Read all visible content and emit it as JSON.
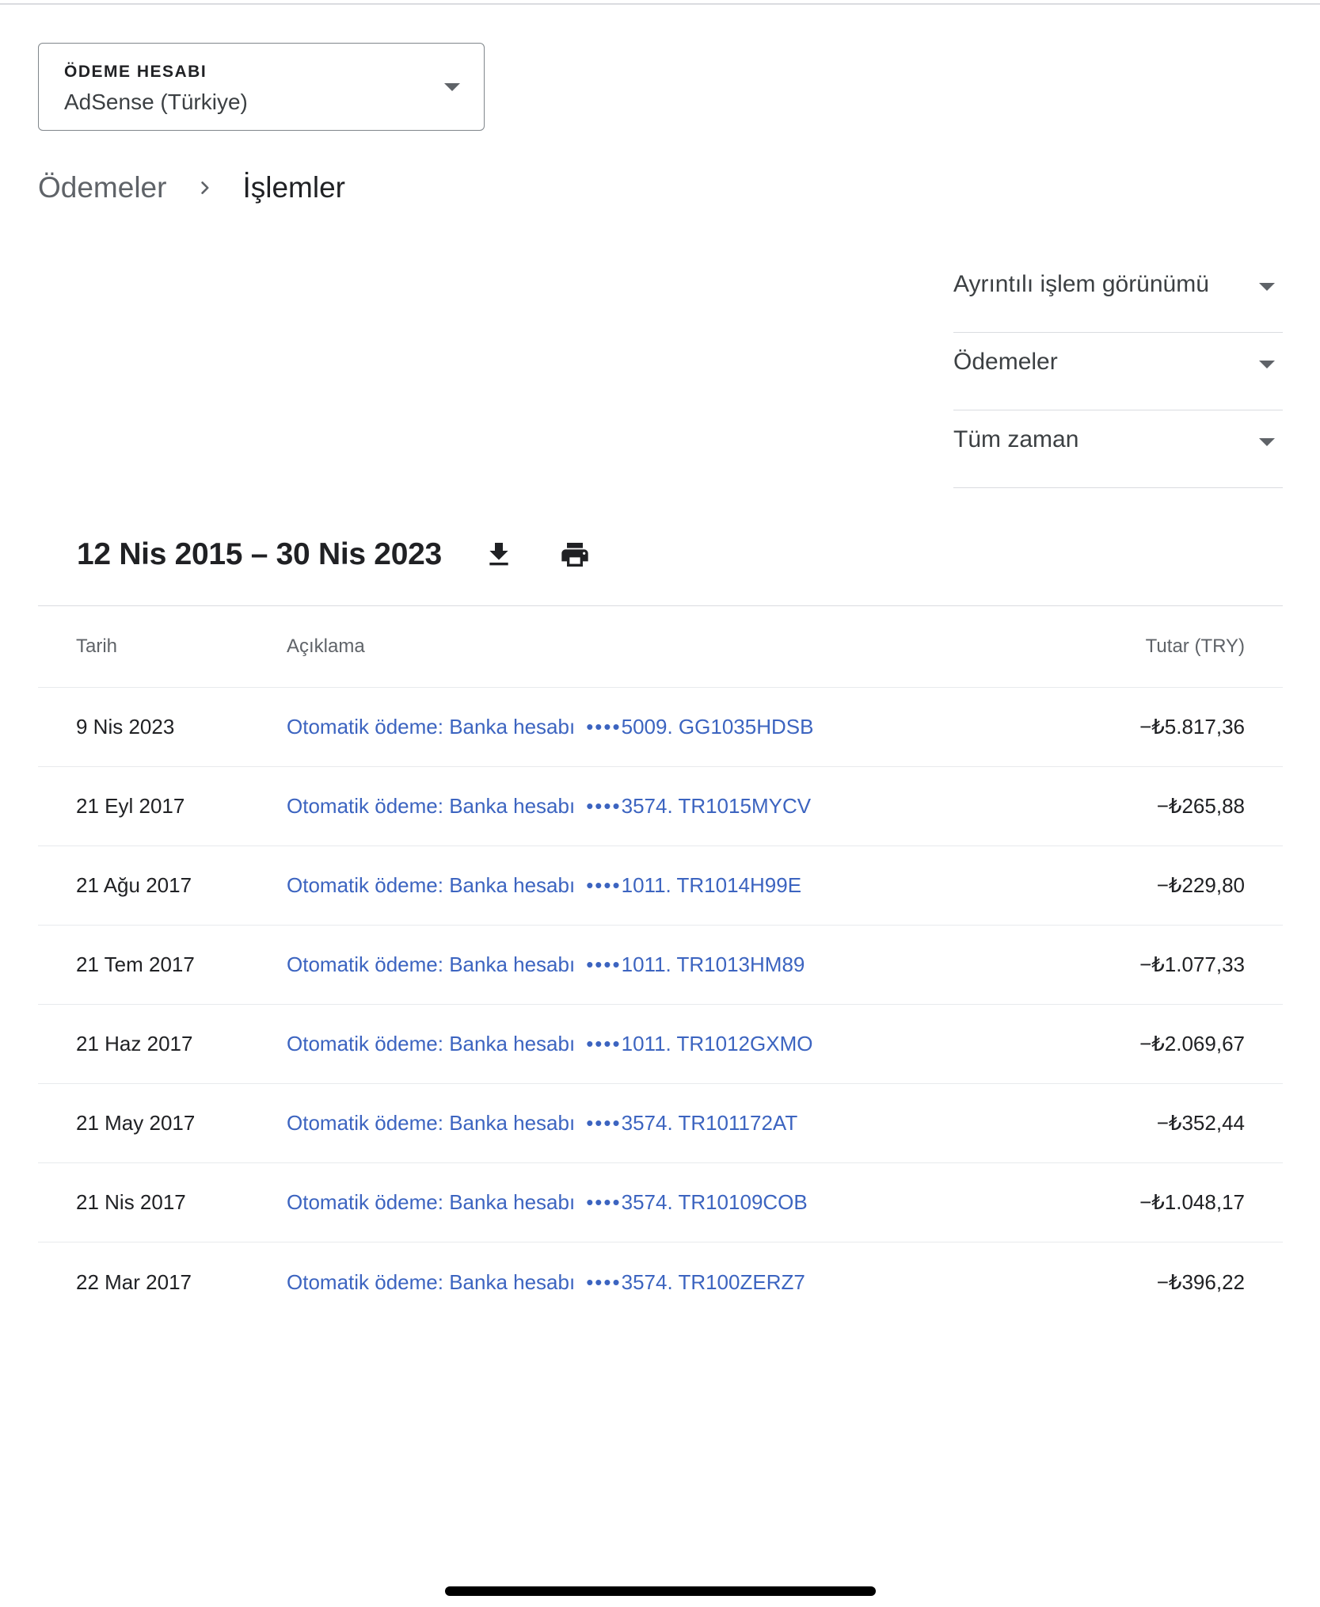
{
  "account": {
    "label": "ÖDEME HESABI",
    "value": "AdSense (Türkiye)"
  },
  "breadcrumb": {
    "parent": "Ödemeler",
    "current": "İşlemler"
  },
  "filters": [
    {
      "label": "Ayrıntılı işlem görünümü"
    },
    {
      "label": "Ödemeler"
    },
    {
      "label": "Tüm zaman"
    }
  ],
  "range": {
    "title": "12 Nis 2015 – 30 Nis 2023"
  },
  "icons": [
    "chevron-right-icon",
    "dropdown-arrow-icon",
    "download-icon",
    "print-icon"
  ],
  "table": {
    "headers": {
      "date": "Tarih",
      "description": "Açıklama",
      "amount": "Tutar (TRY)"
    },
    "rows": [
      {
        "date": "9 Nis 2023",
        "desc": "Otomatik ödeme: Banka hesabı",
        "dots": "••••",
        "ref": "5009. GG1035HDSB",
        "amount": "−₺5.817,36"
      },
      {
        "date": "21 Eyl 2017",
        "desc": "Otomatik ödeme: Banka hesabı",
        "dots": "••••",
        "ref": "3574. TR1015MYCV",
        "amount": "−₺265,88"
      },
      {
        "date": "21 Ağu 2017",
        "desc": "Otomatik ödeme: Banka hesabı",
        "dots": "••••",
        "ref": "1011. TR1014H99E",
        "amount": "−₺229,80"
      },
      {
        "date": "21 Tem 2017",
        "desc": "Otomatik ödeme: Banka hesabı",
        "dots": "••••",
        "ref": "1011. TR1013HM89",
        "amount": "−₺1.077,33"
      },
      {
        "date": "21 Haz 2017",
        "desc": "Otomatik ödeme: Banka hesabı",
        "dots": "••••",
        "ref": "1011. TR1012GXMO",
        "amount": "−₺2.069,67"
      },
      {
        "date": "21 May 2017",
        "desc": "Otomatik ödeme: Banka hesabı",
        "dots": "••••",
        "ref": "3574. TR101172AT",
        "amount": "−₺352,44"
      },
      {
        "date": "21 Nis 2017",
        "desc": "Otomatik ödeme: Banka hesabı",
        "dots": "••••",
        "ref": "3574. TR10109COB",
        "amount": "−₺1.048,17"
      },
      {
        "date": "22 Mar 2017",
        "desc": "Otomatik ödeme: Banka hesabı",
        "dots": "••••",
        "ref": "3574. TR100ZERZ7",
        "amount": "−₺396,22"
      }
    ]
  },
  "colors": {
    "link": "#3c64c0",
    "text": "#202124",
    "muted": "#5f6368",
    "divider": "#dadce0"
  }
}
